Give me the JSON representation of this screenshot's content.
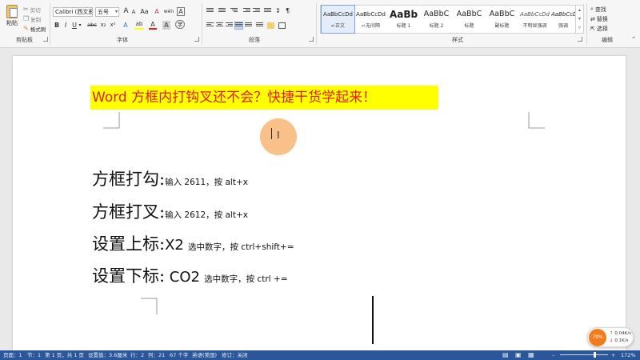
{
  "ribbon": {
    "clipboard": {
      "paste_label": "粘贴",
      "cut_label": "剪切",
      "copy_label": "复制",
      "format_painter_label": "格式刷",
      "group_label": "剪贴板"
    },
    "font": {
      "font_name": "Calibri (西文正",
      "font_size": "五号",
      "group_label": "字体",
      "grow_label": "A",
      "shrink_label": "A",
      "change_case_label": "Aa",
      "clear_format_label": "A",
      "pinyin_label": "wén",
      "border_label": "A",
      "bold_label": "B",
      "italic_label": "I",
      "underline_label": "U",
      "strike_label": "abc",
      "subscript_label": "x₂",
      "superscript_label": "x²",
      "effects_label": "A",
      "highlight_label": "ab",
      "color_label": "A",
      "shade_label": "A",
      "circle_label": "字",
      "highlight_color": "#ffff00",
      "font_color": "#e0211b"
    },
    "paragraph": {
      "group_label": "段落",
      "sort_label": "↕",
      "marks_label": "¶"
    },
    "styles": {
      "group_label": "样式",
      "items": [
        {
          "sample": "AaBbCcDd",
          "name": "↵正文"
        },
        {
          "sample": "AaBbCcDd",
          "name": "↵无间隔"
        },
        {
          "sample": "AaBb",
          "name": "标题 1"
        },
        {
          "sample": "AaBbC",
          "name": "标题 2"
        },
        {
          "sample": "AaBbC",
          "name": "标题"
        },
        {
          "sample": "AaBbC",
          "name": "副标题"
        },
        {
          "sample": "AaBbCcDd",
          "name": "不明显强调"
        },
        {
          "sample": "AaBbCcDd",
          "name": "强调"
        }
      ]
    },
    "editing": {
      "find_label": "查找",
      "replace_label": "替换",
      "select_label": "选择",
      "group_label": "编辑"
    }
  },
  "document": {
    "heading": "Word 方框内打钩叉还不会？快捷干货学起来！",
    "heading_highlight": "#ffff00",
    "heading_color": "#e0211b",
    "lines": [
      {
        "title": "方框打勾:",
        "desc": "输入 2611，按 alt+x"
      },
      {
        "title": "方框打叉:",
        "desc": "输入 2612，按 alt+x"
      },
      {
        "title": "设置上标:",
        "value": "X2",
        "desc": "选中数字，按 ctrl+shift+="
      },
      {
        "title": "设置下标:",
        "value": " CO2",
        "desc": "选中数字，按 ctrl +="
      }
    ]
  },
  "net_widget": {
    "percent": "79%",
    "up": "0.04K/s",
    "down": "0.1K/s"
  },
  "status": {
    "page": "页面：1",
    "section": "节：1",
    "page_of": "第 1 页，共 1 页",
    "position": "设置值：3.6厘米",
    "row": "行：2",
    "column": "列：21",
    "word_count": "67 个字",
    "language": "英语(美国)",
    "track_changes": "修订：关闭",
    "zoom": "172%",
    "zoom_fraction": 0.72
  }
}
